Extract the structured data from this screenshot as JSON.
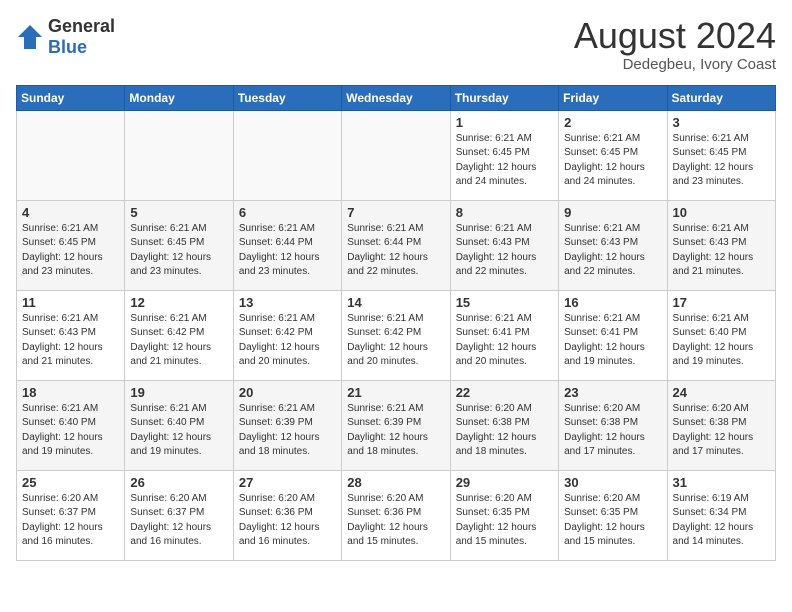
{
  "logo": {
    "text_general": "General",
    "text_blue": "Blue"
  },
  "header": {
    "title": "August 2024",
    "subtitle": "Dedegbeu, Ivory Coast"
  },
  "weekdays": [
    "Sunday",
    "Monday",
    "Tuesday",
    "Wednesday",
    "Thursday",
    "Friday",
    "Saturday"
  ],
  "weeks": [
    [
      {
        "day": "",
        "info": ""
      },
      {
        "day": "",
        "info": ""
      },
      {
        "day": "",
        "info": ""
      },
      {
        "day": "",
        "info": ""
      },
      {
        "day": "1",
        "info": "Sunrise: 6:21 AM\nSunset: 6:45 PM\nDaylight: 12 hours\nand 24 minutes."
      },
      {
        "day": "2",
        "info": "Sunrise: 6:21 AM\nSunset: 6:45 PM\nDaylight: 12 hours\nand 24 minutes."
      },
      {
        "day": "3",
        "info": "Sunrise: 6:21 AM\nSunset: 6:45 PM\nDaylight: 12 hours\nand 23 minutes."
      }
    ],
    [
      {
        "day": "4",
        "info": "Sunrise: 6:21 AM\nSunset: 6:45 PM\nDaylight: 12 hours\nand 23 minutes."
      },
      {
        "day": "5",
        "info": "Sunrise: 6:21 AM\nSunset: 6:45 PM\nDaylight: 12 hours\nand 23 minutes."
      },
      {
        "day": "6",
        "info": "Sunrise: 6:21 AM\nSunset: 6:44 PM\nDaylight: 12 hours\nand 23 minutes."
      },
      {
        "day": "7",
        "info": "Sunrise: 6:21 AM\nSunset: 6:44 PM\nDaylight: 12 hours\nand 22 minutes."
      },
      {
        "day": "8",
        "info": "Sunrise: 6:21 AM\nSunset: 6:43 PM\nDaylight: 12 hours\nand 22 minutes."
      },
      {
        "day": "9",
        "info": "Sunrise: 6:21 AM\nSunset: 6:43 PM\nDaylight: 12 hours\nand 22 minutes."
      },
      {
        "day": "10",
        "info": "Sunrise: 6:21 AM\nSunset: 6:43 PM\nDaylight: 12 hours\nand 21 minutes."
      }
    ],
    [
      {
        "day": "11",
        "info": "Sunrise: 6:21 AM\nSunset: 6:43 PM\nDaylight: 12 hours\nand 21 minutes."
      },
      {
        "day": "12",
        "info": "Sunrise: 6:21 AM\nSunset: 6:42 PM\nDaylight: 12 hours\nand 21 minutes."
      },
      {
        "day": "13",
        "info": "Sunrise: 6:21 AM\nSunset: 6:42 PM\nDaylight: 12 hours\nand 20 minutes."
      },
      {
        "day": "14",
        "info": "Sunrise: 6:21 AM\nSunset: 6:42 PM\nDaylight: 12 hours\nand 20 minutes."
      },
      {
        "day": "15",
        "info": "Sunrise: 6:21 AM\nSunset: 6:41 PM\nDaylight: 12 hours\nand 20 minutes."
      },
      {
        "day": "16",
        "info": "Sunrise: 6:21 AM\nSunset: 6:41 PM\nDaylight: 12 hours\nand 19 minutes."
      },
      {
        "day": "17",
        "info": "Sunrise: 6:21 AM\nSunset: 6:40 PM\nDaylight: 12 hours\nand 19 minutes."
      }
    ],
    [
      {
        "day": "18",
        "info": "Sunrise: 6:21 AM\nSunset: 6:40 PM\nDaylight: 12 hours\nand 19 minutes."
      },
      {
        "day": "19",
        "info": "Sunrise: 6:21 AM\nSunset: 6:40 PM\nDaylight: 12 hours\nand 19 minutes."
      },
      {
        "day": "20",
        "info": "Sunrise: 6:21 AM\nSunset: 6:39 PM\nDaylight: 12 hours\nand 18 minutes."
      },
      {
        "day": "21",
        "info": "Sunrise: 6:21 AM\nSunset: 6:39 PM\nDaylight: 12 hours\nand 18 minutes."
      },
      {
        "day": "22",
        "info": "Sunrise: 6:20 AM\nSunset: 6:38 PM\nDaylight: 12 hours\nand 18 minutes."
      },
      {
        "day": "23",
        "info": "Sunrise: 6:20 AM\nSunset: 6:38 PM\nDaylight: 12 hours\nand 17 minutes."
      },
      {
        "day": "24",
        "info": "Sunrise: 6:20 AM\nSunset: 6:38 PM\nDaylight: 12 hours\nand 17 minutes."
      }
    ],
    [
      {
        "day": "25",
        "info": "Sunrise: 6:20 AM\nSunset: 6:37 PM\nDaylight: 12 hours\nand 16 minutes."
      },
      {
        "day": "26",
        "info": "Sunrise: 6:20 AM\nSunset: 6:37 PM\nDaylight: 12 hours\nand 16 minutes."
      },
      {
        "day": "27",
        "info": "Sunrise: 6:20 AM\nSunset: 6:36 PM\nDaylight: 12 hours\nand 16 minutes."
      },
      {
        "day": "28",
        "info": "Sunrise: 6:20 AM\nSunset: 6:36 PM\nDaylight: 12 hours\nand 15 minutes."
      },
      {
        "day": "29",
        "info": "Sunrise: 6:20 AM\nSunset: 6:35 PM\nDaylight: 12 hours\nand 15 minutes."
      },
      {
        "day": "30",
        "info": "Sunrise: 6:20 AM\nSunset: 6:35 PM\nDaylight: 12 hours\nand 15 minutes."
      },
      {
        "day": "31",
        "info": "Sunrise: 6:19 AM\nSunset: 6:34 PM\nDaylight: 12 hours\nand 14 minutes."
      }
    ]
  ]
}
